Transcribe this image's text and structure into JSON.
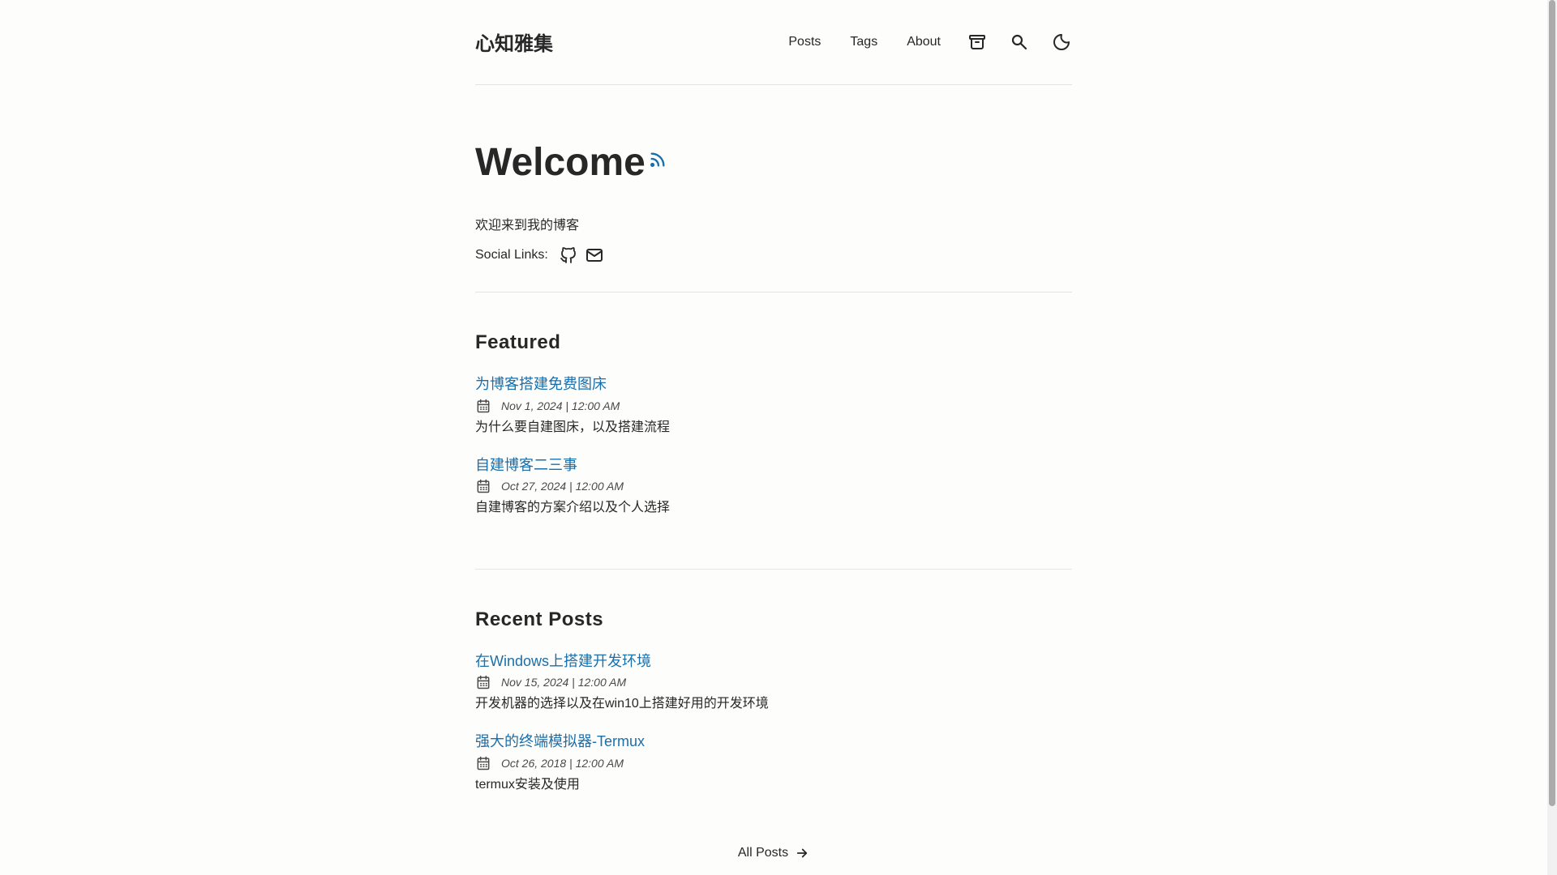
{
  "site": {
    "logo": "心知雅集"
  },
  "nav": {
    "items": [
      {
        "label": "Posts"
      },
      {
        "label": "Tags"
      },
      {
        "label": "About"
      }
    ],
    "icons": [
      "archive-icon",
      "search-icon",
      "moon-icon"
    ]
  },
  "hero": {
    "title": "Welcome",
    "description": "欢迎来到我的博客",
    "social_label": "Social Links:",
    "social_icons": [
      "github-icon",
      "mail-icon"
    ]
  },
  "featured": {
    "heading": "Featured",
    "posts": [
      {
        "title": "为博客搭建免费图床",
        "date": "Nov 1, 2024 | 12:00 AM",
        "description": "为什么要自建图床，以及搭建流程"
      },
      {
        "title": "自建博客二三事",
        "date": "Oct 27, 2024 | 12:00 AM",
        "description": "自建博客的方案介绍以及个人选择"
      }
    ]
  },
  "recent": {
    "heading": "Recent Posts",
    "posts": [
      {
        "title": "在Windows上搭建开发环境",
        "date": "Nov 15, 2024 | 12:00 AM",
        "description": "开发机器的选择以及在win10上搭建好用的开发环境"
      },
      {
        "title": "强大的终端模拟器-Termux",
        "date": "Oct 26, 2018 | 12:00 AM",
        "description": "termux安装及使用"
      }
    ]
  },
  "footer_link": {
    "label": "All Posts"
  },
  "colors": {
    "accent": "#1a6fab",
    "text": "#282728",
    "background": "#fdfdfc"
  }
}
